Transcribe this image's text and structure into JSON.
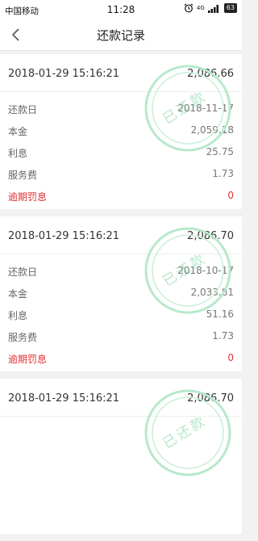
{
  "status": {
    "carrier": "中国移动",
    "time": "11:28",
    "signal": "4G",
    "battery": "63"
  },
  "nav": {
    "title": "还款记录"
  },
  "labels": {
    "repay_date": "还款日",
    "principal": "本金",
    "interest": "利息",
    "fee": "服务费",
    "penalty": "逾期罚息"
  },
  "stamp_text": "已还款",
  "colors": {
    "penalty": "#e23030",
    "stamp": "#7ed2a2",
    "background": "#f2f2f2"
  },
  "records": [
    {
      "datetime": "2018-01-29 15:16:21",
      "amount": "2,086.66",
      "repay_date": "2018-11-17",
      "principal": "2,059.18",
      "interest": "25.75",
      "fee": "1.73",
      "penalty": "0"
    },
    {
      "datetime": "2018-01-29 15:16:21",
      "amount": "2,086.70",
      "repay_date": "2018-10-17",
      "principal": "2,033.81",
      "interest": "51.16",
      "fee": "1.73",
      "penalty": "0"
    },
    {
      "datetime": "2018-01-29 15:16:21",
      "amount": "2,086.70"
    }
  ]
}
